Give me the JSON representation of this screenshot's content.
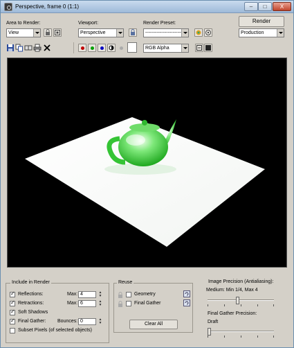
{
  "window": {
    "title": "Perspective, frame 0 (1:1)"
  },
  "titlebar_controls": {
    "minimize": "–",
    "maximize": "□",
    "close": "X"
  },
  "toolbar": {
    "area_label": "Area to Render:",
    "area_value": "View",
    "viewport_label": "Viewport:",
    "viewport_value": "Perspective",
    "preset_label": "Render Preset:",
    "preset_value": "--------------------------",
    "render_button": "Render",
    "render_mode": "Production",
    "channel_value": "RGB Alpha"
  },
  "colors": {
    "red_channel": "#c00000",
    "green_channel": "#00a000",
    "blue_channel": "#0000c0",
    "viewport_bg": "#000000",
    "plane": "#ffffff",
    "teapot": "#3fd83f"
  },
  "icons": {
    "area_lock": "lock-icon",
    "area_frame": "crop-icon",
    "save": "save-icon",
    "copy": "copy-icon",
    "clone": "clone-window-icon",
    "print": "print-icon",
    "clear": "clear-x-icon"
  },
  "include": {
    "title": "Include in Render",
    "reflections": {
      "label": "Reflections:",
      "checked": true,
      "max_label": "Max:",
      "max": "4"
    },
    "refractions": {
      "label": "Retractions:",
      "checked": true,
      "max_label": "Max:",
      "max": "6"
    },
    "soft_shadows": {
      "label": "Soft Shadows",
      "checked": true
    },
    "final_gather": {
      "label": "Final Gather:",
      "checked": true,
      "bounces_label": "Bounces:",
      "bounces": "0"
    },
    "subset": {
      "label": "Subset Pixels (of selected objects)",
      "checked": false
    }
  },
  "reuse": {
    "title": "Reuse",
    "geometry": "Geometry",
    "final_gather": "Final Gather",
    "clear_all": "Clear All"
  },
  "precision": {
    "image_title": "Image Precision (Antialiasing):",
    "image_value": "Medium: Min 1/4, Max 4",
    "image_level": 0.45,
    "fg_title": "Final Gather Precision:",
    "fg_value": "Draft",
    "fg_level": 0.0
  }
}
